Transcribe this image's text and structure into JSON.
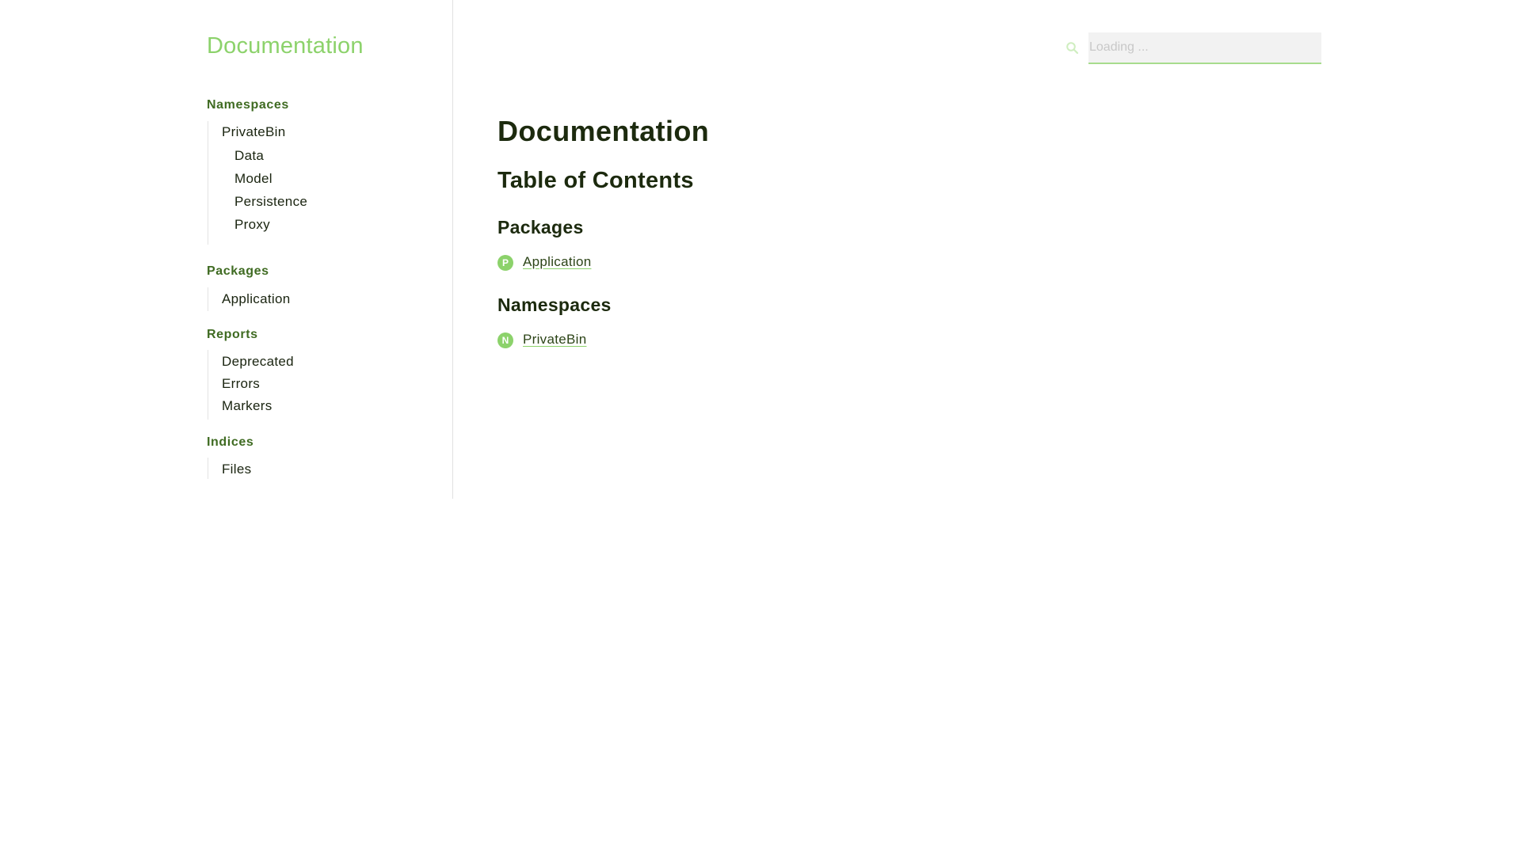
{
  "sidebar": {
    "brand": "Documentation",
    "namespaces": {
      "title": "Namespaces",
      "root": "PrivateBin",
      "children": [
        "Data",
        "Model",
        "Persistence",
        "Proxy"
      ]
    },
    "packages": {
      "title": "Packages",
      "items": [
        "Application"
      ]
    },
    "reports": {
      "title": "Reports",
      "items": [
        "Deprecated",
        "Errors",
        "Markers"
      ]
    },
    "indices": {
      "title": "Indices",
      "items": [
        "Files"
      ]
    }
  },
  "search": {
    "placeholder": "Loading ...",
    "icon": "search-icon"
  },
  "content": {
    "title": "Documentation",
    "toc_title": "Table of Contents",
    "packages": {
      "heading": "Packages",
      "badge": "P",
      "items": [
        "Application"
      ]
    },
    "namespaces": {
      "heading": "Namespaces",
      "badge": "N",
      "items": [
        "PrivateBin"
      ]
    }
  },
  "colors": {
    "accent": "#8cd26b",
    "section_title": "#3f6b22",
    "text": "#1c2a0e"
  }
}
